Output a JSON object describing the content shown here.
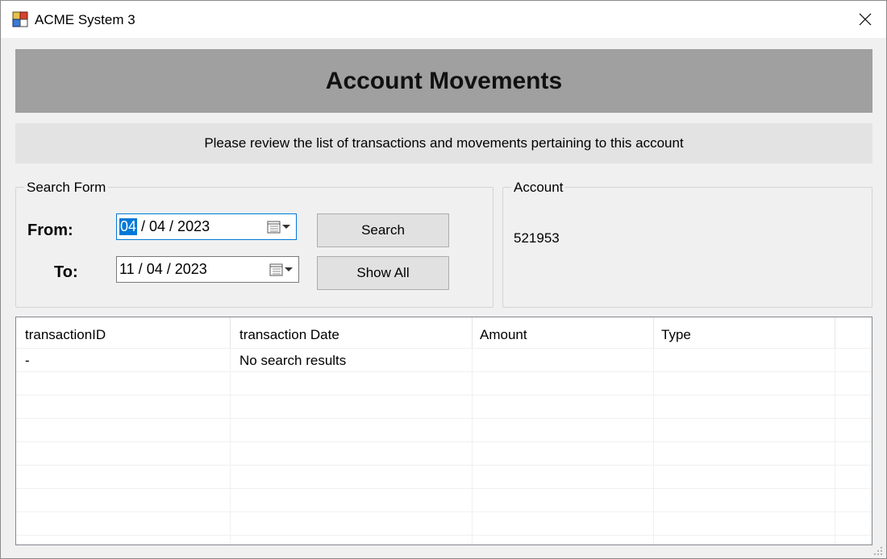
{
  "window": {
    "title": "ACME System 3"
  },
  "header": {
    "title": "Account Movements",
    "subtitle": "Please review the list of transactions and movements pertaining to this account"
  },
  "search_form": {
    "legend": "Search Form",
    "from_label": "From:",
    "to_label": "To:",
    "from_day": "04",
    "from_rest": " / 04 / 2023",
    "to_date": "11 / 04 / 2023",
    "search_button": "Search",
    "show_all_button": "Show All"
  },
  "account": {
    "legend": "Account",
    "number": "521953"
  },
  "table": {
    "columns": [
      "transactionID",
      "transaction Date",
      "Amount",
      "Type"
    ],
    "rows": [
      [
        "-",
        "No search results",
        "",
        ""
      ]
    ]
  },
  "colors": {
    "header_bg": "#a0a0a0",
    "subheader_bg": "#e3e3e3",
    "selection": "#0078d7",
    "window_bg": "#f0f0f0"
  },
  "icons": {
    "app": "acme-app-icon",
    "close": "close-icon",
    "calendar": "calendar-dropdown-icon",
    "resize": "size-grip-icon"
  }
}
